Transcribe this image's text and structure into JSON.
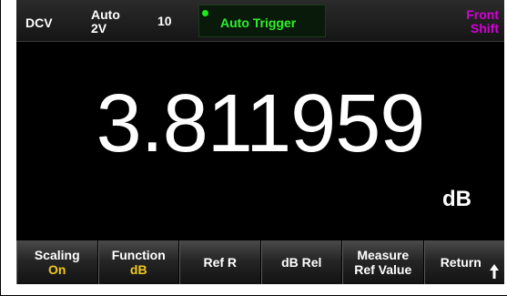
{
  "status": {
    "mode": "DCV",
    "range_line1": "Auto",
    "range_line2": "2V",
    "digits": "10",
    "trigger": "Auto Trigger",
    "trigger_icon": "green-dot-icon",
    "front_line1": "Front",
    "front_line2": "Shift"
  },
  "display": {
    "reading": "3.811959",
    "unit": "dB"
  },
  "softkeys": [
    {
      "label": "Scaling",
      "value": "On"
    },
    {
      "label": "Function",
      "value": "dB"
    },
    {
      "label": "Ref R",
      "value": ""
    },
    {
      "label": "dB Rel",
      "value": ""
    },
    {
      "label": "Measure",
      "value": "Ref Value"
    },
    {
      "label": "Return",
      "value": ""
    }
  ],
  "colors": {
    "background": "#000000",
    "trigger_text": "#2cf02c",
    "front_shift": "#d400d4",
    "softkey_value": "#f0c81e"
  }
}
